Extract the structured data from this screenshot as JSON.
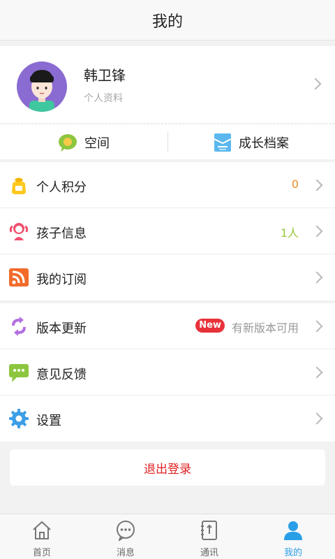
{
  "header": {
    "title": "我的"
  },
  "profile": {
    "name": "韩卫锋",
    "subtitle": "个人资料"
  },
  "quick": {
    "space_label": "空间",
    "growth_label": "成长档案"
  },
  "group1": {
    "points": {
      "label": "个人积分",
      "value": "0",
      "value_color": "#f08a24"
    },
    "children": {
      "label": "孩子信息",
      "value": "1人",
      "value_color": "#9ac83a"
    },
    "subscription": {
      "label": "我的订阅"
    }
  },
  "group2": {
    "update": {
      "label": "版本更新",
      "badge": "New",
      "status": "有新版本可用"
    },
    "feedback": {
      "label": "意见反馈"
    },
    "settings": {
      "label": "设置"
    }
  },
  "logout_label": "退出登录",
  "tabs": [
    {
      "label": "首页",
      "icon": "home-icon"
    },
    {
      "label": "消息",
      "icon": "chat-icon"
    },
    {
      "label": "通讯",
      "icon": "contacts-icon"
    },
    {
      "label": "我的",
      "icon": "person-icon",
      "active": true
    }
  ],
  "colors": {
    "accent": "#2a9fe8",
    "logout": "#e02020",
    "avatar_bg": "#8a6bd1"
  }
}
